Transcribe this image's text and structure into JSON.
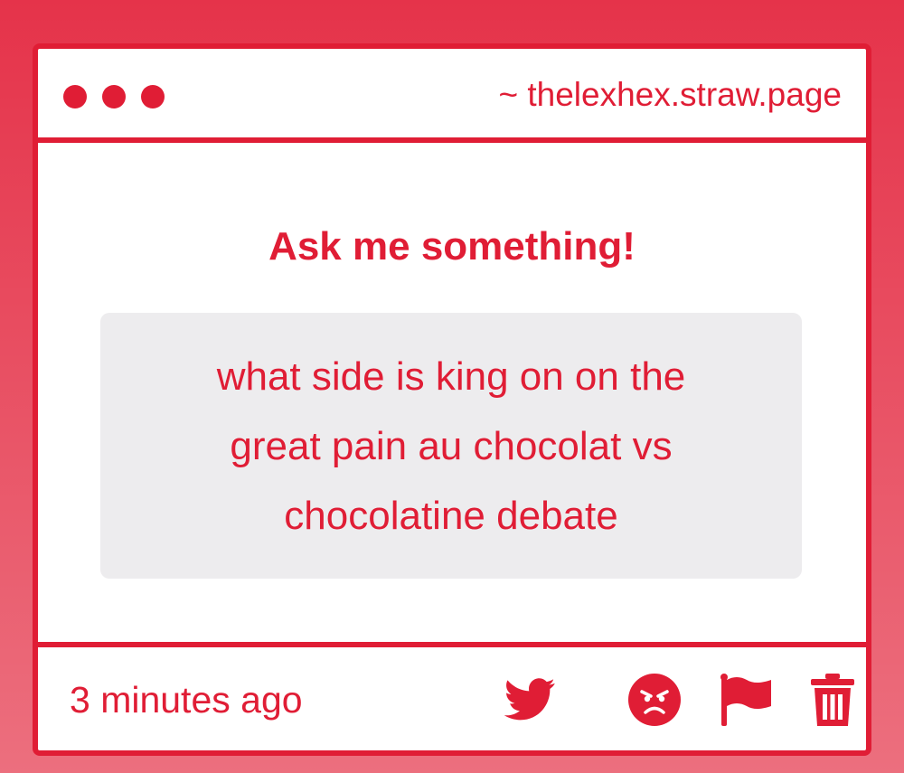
{
  "window": {
    "dots": [
      "dot",
      "dot",
      "dot"
    ],
    "url": "~ thelexhex.straw.page"
  },
  "main": {
    "heading": "Ask me something!",
    "question": "what side is king on on the great pain au chocolat vs chocolatine debate"
  },
  "footer": {
    "timestamp": "3 minutes ago",
    "actions": [
      {
        "icon": "twitter-icon"
      },
      {
        "icon": "angry-face-icon"
      },
      {
        "icon": "flag-icon"
      },
      {
        "icon": "trash-icon"
      }
    ]
  },
  "colors": {
    "accent": "#e01d35",
    "background_top": "#e5334a",
    "background_bottom": "#ec6f7e",
    "question_box": "#edecee",
    "card": "#ffffff"
  }
}
